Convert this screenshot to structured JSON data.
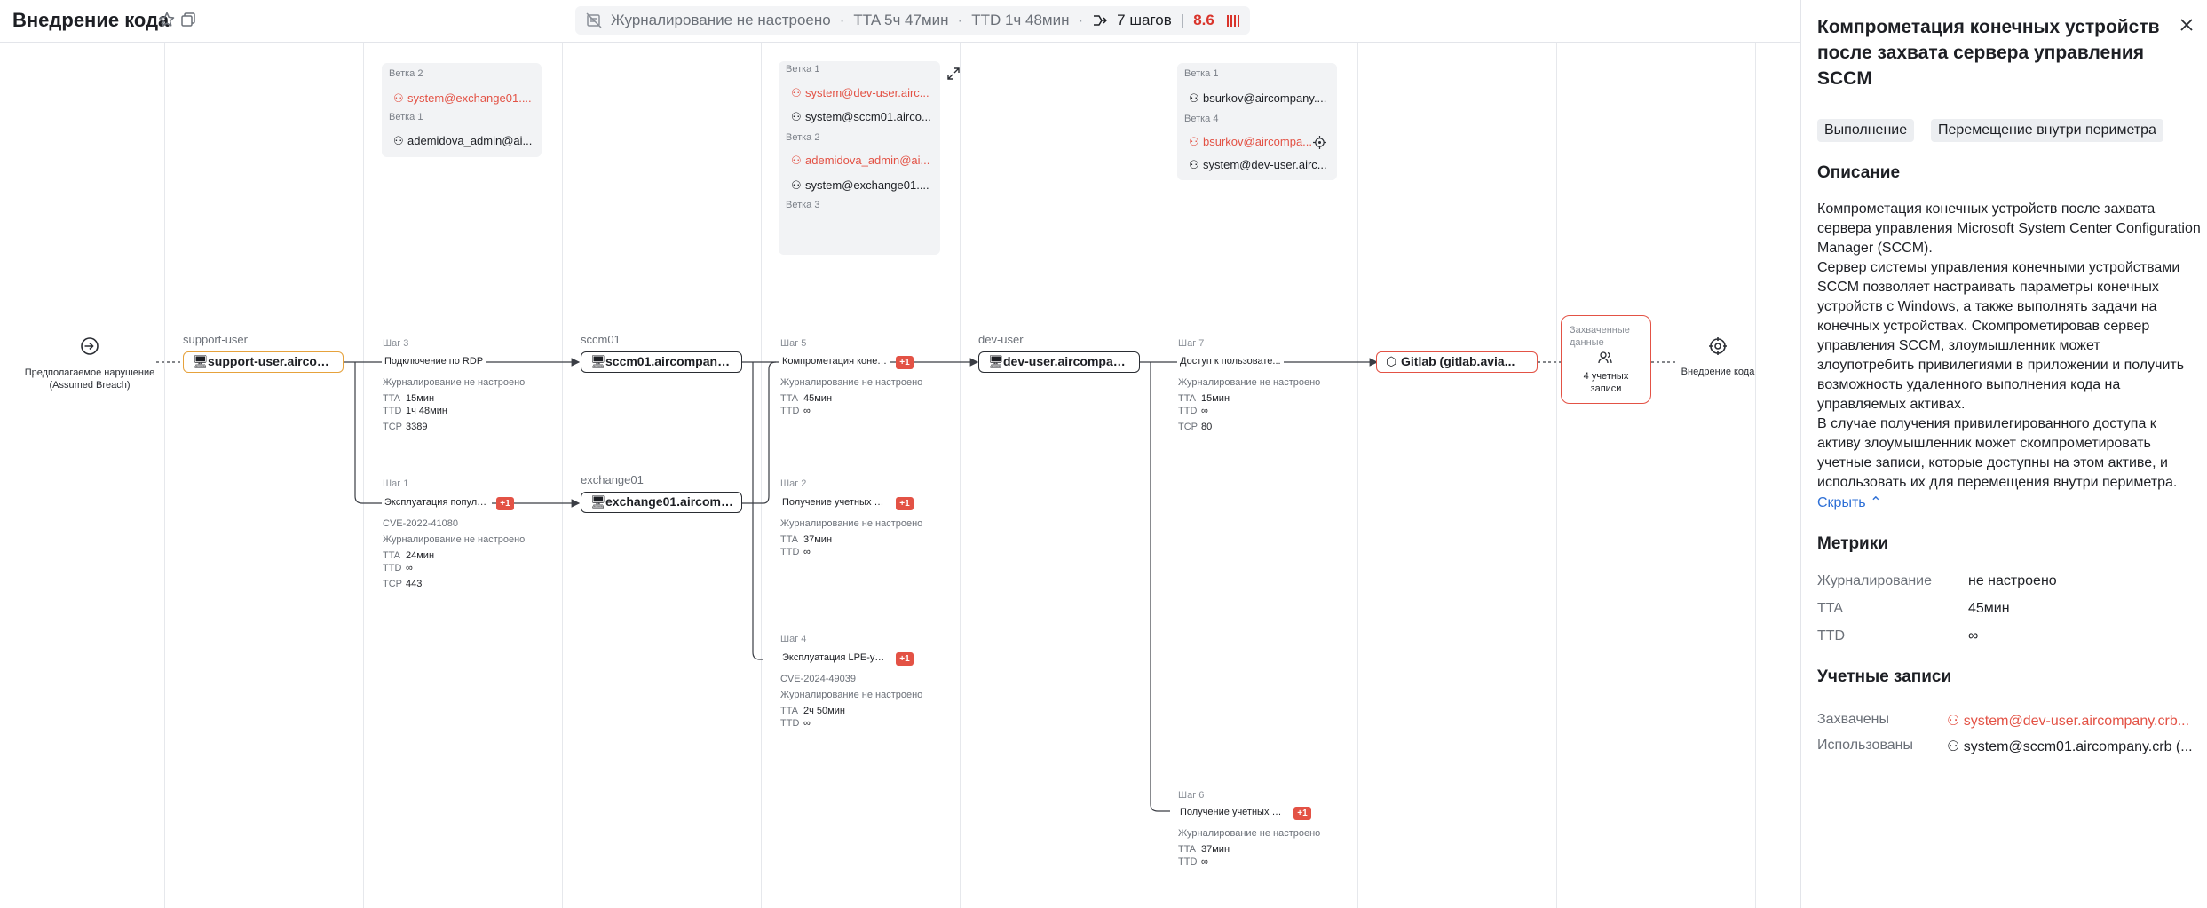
{
  "header": {
    "title": "Внедрение кода",
    "logging": "Журналирование не настроено",
    "tta": "TTA 5ч 47мин",
    "ttd": "TTD 1ч 48мин",
    "steps": "7 шагов",
    "score": "8.6"
  },
  "graph": {
    "start": {
      "label": "Предполагаемое нарушение",
      "sublabel": "(Assumed Breach)"
    },
    "end": {
      "label": "Внедрение кода"
    },
    "hosts": [
      {
        "group": "support-user",
        "node": "support-user.aircom..."
      },
      {
        "group": "sccm01",
        "node": "sccm01.aircompany.crb"
      },
      {
        "group": "exchange01",
        "node": "exchange01.aircompa..."
      },
      {
        "group": "dev-user",
        "node": "dev-user.aircompany...."
      },
      {
        "group": "",
        "node": "Gitlab (gitlab.avia..."
      }
    ],
    "steps": [
      {
        "num": "Шаг 3",
        "title": "Подключение по RDP",
        "badge": "",
        "cve": "",
        "log": "Журналирование не настроено",
        "tta": "15мин",
        "ttd": "1ч 48мин",
        "tcp": "3389"
      },
      {
        "num": "Шаг 1",
        "title": "Эксплуатация популя...",
        "badge": "+1",
        "cve": "CVE-2022-41080",
        "log": "Журналирование не настроено",
        "tta": "24мин",
        "ttd": "∞",
        "tcp": "443"
      },
      {
        "num": "Шаг 5",
        "title": "Компрометация конеч...",
        "badge": "+1",
        "cve": "",
        "log": "Журналирование не настроено",
        "tta": "45мин",
        "ttd": "∞",
        "tcp": ""
      },
      {
        "num": "Шаг 2",
        "title": "Получение учетных д...",
        "badge": "+1",
        "cve": "",
        "log": "Журналирование не настроено",
        "tta": "37мин",
        "ttd": "∞",
        "tcp": ""
      },
      {
        "num": "Шаг 4",
        "title": "Эксплуатация LPE-уя...",
        "badge": "+1",
        "cve": "CVE-2024-49039",
        "log": "Журналирование не настроено",
        "tta": "2ч 50мин",
        "ttd": "∞",
        "tcp": ""
      },
      {
        "num": "Шаг 7",
        "title": "Доступ к пользовате...",
        "badge": "",
        "cve": "",
        "log": "Журналирование не настроено",
        "tta": "15мин",
        "ttd": "∞",
        "tcp": "80"
      },
      {
        "num": "Шаг 6",
        "title": "Получение учетных д...",
        "badge": "+1",
        "cve": "",
        "log": "Журналирование не настроено",
        "tta": "37мин",
        "ttd": "∞",
        "tcp": ""
      }
    ],
    "branch_boxes": [
      {
        "entries": [
          {
            "label": "Ветка 2",
            "account": "system@exchange01....",
            "captured": true
          },
          {
            "label": "Ветка 1",
            "account": "ademidova_admin@ai...",
            "captured": false
          }
        ]
      },
      {
        "entries": [
          {
            "label": "Ветка 1",
            "account": "system@dev-user.airc...",
            "captured": true
          },
          {
            "label": "",
            "account": "system@sccm01.airco...",
            "captured": false
          },
          {
            "label": "Ветка 2",
            "account": "ademidova_admin@ai...",
            "captured": true
          },
          {
            "label": "",
            "account": "system@exchange01....",
            "captured": false
          },
          {
            "label": "Ветка 3",
            "account": "",
            "captured": false
          }
        ]
      },
      {
        "entries": [
          {
            "label": "Ветка 1",
            "account": "bsurkov@aircompany....",
            "captured": false
          },
          {
            "label": "Ветка 4",
            "account": "bsurkov@aircompa...",
            "captured": true
          },
          {
            "label": "",
            "account": "system@dev-user.airc...",
            "captured": false
          }
        ]
      }
    ],
    "captured": {
      "title_line1": "Захваченные",
      "title_line2": "данные",
      "count_line1": "4 учетных",
      "count_line2": "записи"
    },
    "labels": {
      "tta": "TTA",
      "ttd": "TTD",
      "tcp": "TCP"
    }
  },
  "panel": {
    "title": "Компрометация конечных устройств после захвата сервера управления SCCM",
    "tags": [
      "Выполнение",
      "Перемещение внутри периметра"
    ],
    "description_heading": "Описание",
    "description": [
      "Компрометация конечных устройств после захвата сервера управления Microsoft System Center Configuration Manager (SCCM).",
      "Сервер системы управления конечными устройствами SCCM позволяет настраивать параметры конечных устройств с Windows, а также выполнять задачи на конечных устройствах. Скомпрометировав сервер управления SCCM, злоумышленник может злоупотребить привилегиями в приложении и получить возможность удаленного выполнения кода на управляемых активах.",
      "В случае получения привилегированного доступа к активу злоумышленник может скомпрометировать учетные записи, которые доступны на этом активе, и использовать их для перемещения внутри периметра."
    ],
    "hide_label": "Скрыть",
    "metrics_heading": "Метрики",
    "metrics": [
      {
        "key": "Журналирование",
        "value": "не настроено"
      },
      {
        "key": "TTA",
        "value": "45мин"
      },
      {
        "key": "TTD",
        "value": "∞"
      }
    ],
    "accounts_heading": "Учетные записи",
    "accounts": [
      {
        "key": "Захвачены",
        "value": "system@dev-user.aircompany.crb...",
        "captured": true
      },
      {
        "key": "Использованы",
        "value": "system@sccm01.aircompany.crb (...",
        "captured": false
      }
    ]
  }
}
